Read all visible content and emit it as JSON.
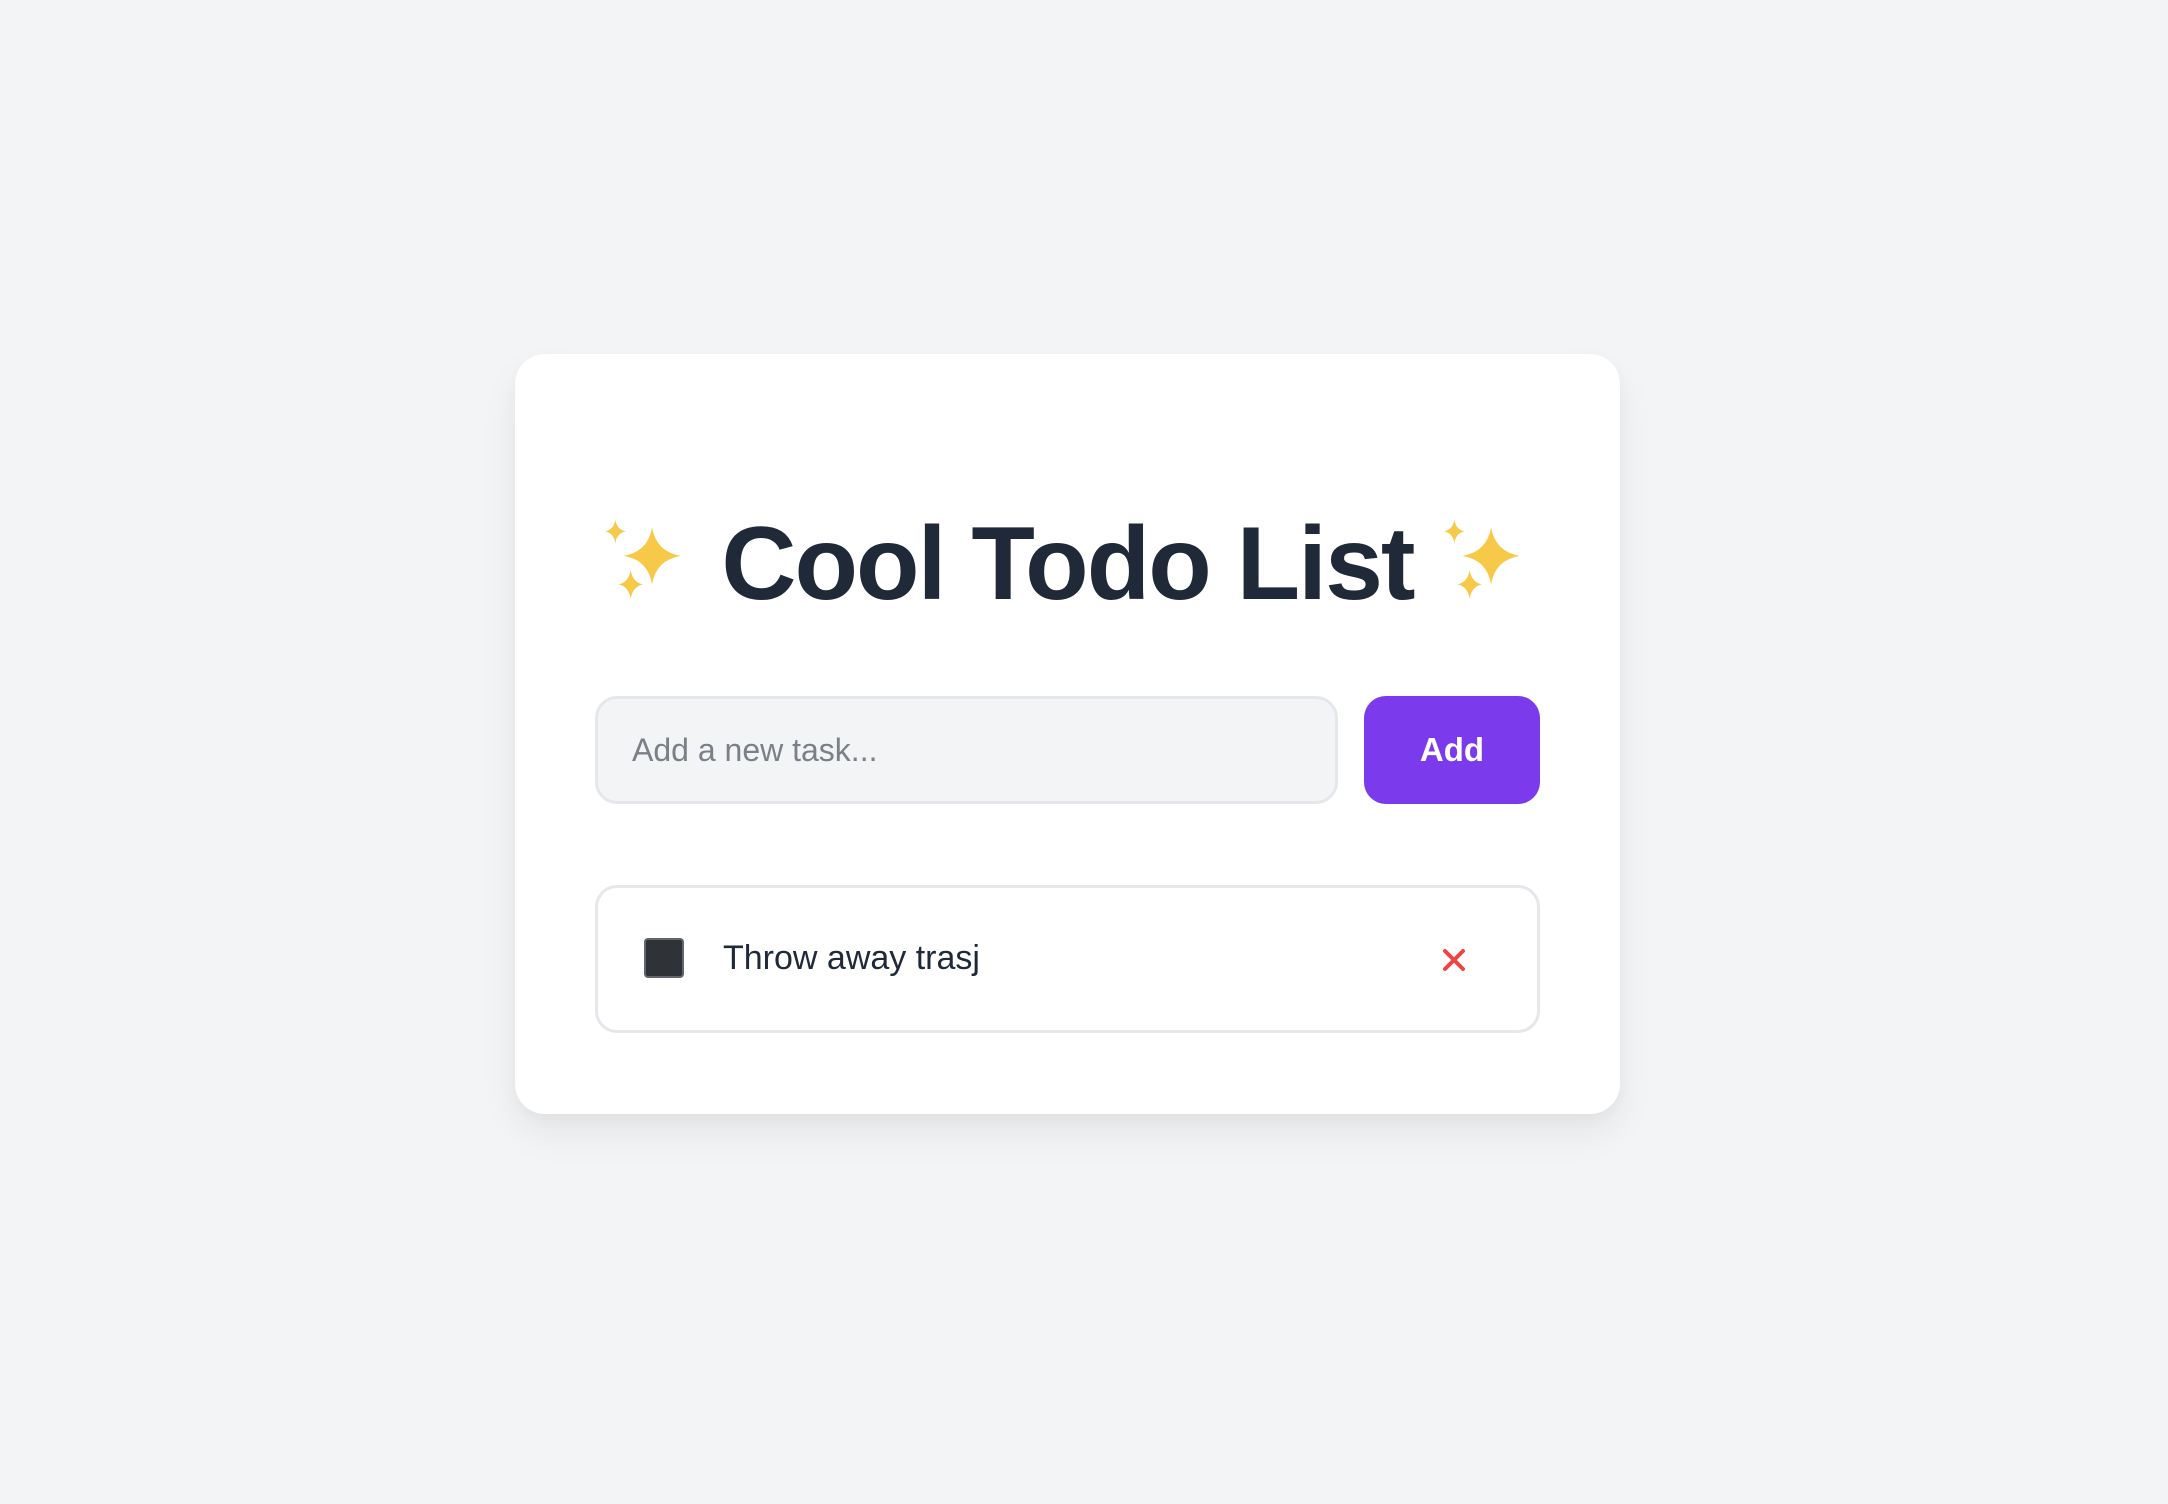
{
  "app": {
    "title": "Cool Todo List"
  },
  "form": {
    "input_value": "",
    "input_placeholder": "Add a new task...",
    "add_label": "Add"
  },
  "todos": [
    {
      "text": "Throw away trasj",
      "completed": false
    }
  ],
  "icons": {
    "title_left": "sparkles-icon",
    "title_right": "sparkles-icon",
    "delete": "close-icon"
  },
  "colors": {
    "background": "#f3f4f6",
    "card": "#ffffff",
    "title": "#1f2937",
    "accent": "#7c3aed",
    "delete": "#ef4444",
    "sparkle": "#f7c948",
    "border": "#e5e7eb"
  }
}
